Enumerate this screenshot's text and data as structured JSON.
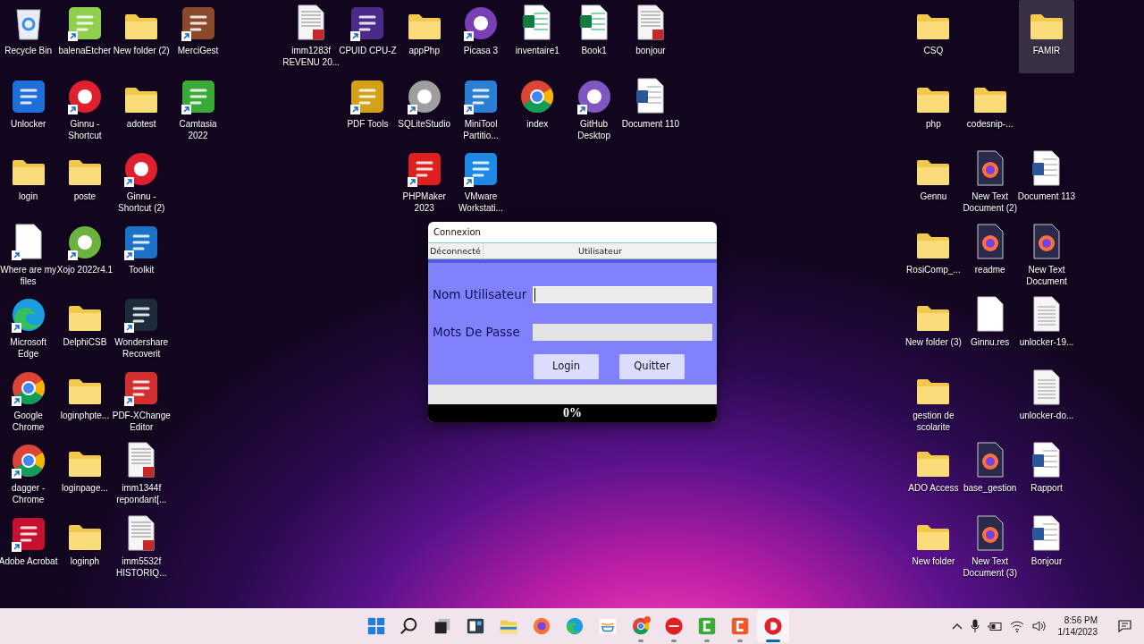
{
  "desktop": {
    "groups": [
      {
        "columns": [
          {
            "icons": [
              {
                "label": "Recycle Bin",
                "kind": "recycle-bin",
                "shortcut": false,
                "selected": false
              },
              {
                "label": "Unlocker",
                "kind": "app-tile",
                "color": "#1e6fd9",
                "shortcut": false,
                "selected": false
              },
              {
                "label": "login",
                "kind": "folder",
                "shortcut": false,
                "selected": false
              },
              {
                "label": "Where are my files",
                "kind": "blank-file",
                "shortcut": true,
                "selected": false
              },
              {
                "label": "Microsoft Edge",
                "kind": "edge",
                "shortcut": true,
                "selected": false
              },
              {
                "label": "Google Chrome",
                "kind": "chrome",
                "shortcut": true,
                "selected": false
              },
              {
                "label": "dagger - Chrome",
                "kind": "chrome",
                "shortcut": true,
                "selected": false
              },
              {
                "label": "Adobe Acrobat",
                "kind": "app-tile",
                "color": "#c8102e",
                "shortcut": true,
                "selected": false
              }
            ]
          },
          {
            "icons": [
              {
                "label": "balenaEtcher",
                "kind": "app-tile",
                "color": "#8fd14f",
                "shortcut": true,
                "selected": false
              },
              {
                "label": "Ginnu - Shortcut",
                "kind": "app-round",
                "color": "#e0202e",
                "shortcut": true,
                "selected": false
              },
              {
                "label": "poste",
                "kind": "folder",
                "shortcut": false,
                "selected": false
              },
              {
                "label": "Xojo 2022r4.1",
                "kind": "app-round",
                "color": "#6ab33e",
                "shortcut": true,
                "selected": false
              },
              {
                "label": "DelphiCSB",
                "kind": "folder",
                "shortcut": false,
                "selected": false
              },
              {
                "label": "loginphpte...",
                "kind": "folder",
                "shortcut": false,
                "selected": false
              },
              {
                "label": "loginpage...",
                "kind": "folder",
                "shortcut": false,
                "selected": false
              },
              {
                "label": "loginph",
                "kind": "folder",
                "shortcut": false,
                "selected": false
              }
            ]
          },
          {
            "icons": [
              {
                "label": "New folder (2)",
                "kind": "folder",
                "shortcut": false,
                "selected": false
              },
              {
                "label": "adotest",
                "kind": "folder",
                "shortcut": false,
                "selected": false
              },
              {
                "label": "Ginnu - Shortcut (2)",
                "kind": "app-round",
                "color": "#e0202e",
                "shortcut": true,
                "selected": false
              },
              {
                "label": "Toolkit",
                "kind": "app-tile",
                "color": "#1a73c8",
                "shortcut": true,
                "selected": false
              },
              {
                "label": "Wondershare Recoverit",
                "kind": "app-tile",
                "color": "#1c2b3a",
                "shortcut": true,
                "selected": false
              },
              {
                "label": "PDF-XChange Editor",
                "kind": "app-tile",
                "color": "#d32f2f",
                "shortcut": true,
                "selected": false
              },
              {
                "label": "imm1344f repondant[...",
                "kind": "pdf-file",
                "shortcut": false,
                "selected": false
              },
              {
                "label": "imm5532f HISTORIQ...",
                "kind": "pdf-file",
                "shortcut": false,
                "selected": false
              }
            ]
          },
          {
            "icons": [
              {
                "label": "MerciGest",
                "kind": "app-tile",
                "color": "#8b4a2b",
                "shortcut": true,
                "selected": false
              },
              {
                "label": "Camtasia 2022",
                "kind": "app-tile",
                "color": "#3aa935",
                "shortcut": true,
                "selected": false
              }
            ]
          }
        ]
      },
      {
        "columns": [
          {
            "icons": [
              {
                "label": "imm1283f REVENU 20...",
                "kind": "pdf-file",
                "shortcut": false,
                "selected": false
              }
            ]
          },
          {
            "icons": [
              {
                "label": "CPUID CPU-Z",
                "kind": "app-tile",
                "color": "#4b2a8a",
                "shortcut": true,
                "selected": false
              },
              {
                "label": "PDF Tools",
                "kind": "app-tile",
                "color": "#d4a017",
                "shortcut": true,
                "selected": false
              }
            ]
          },
          {
            "icons": [
              {
                "label": "appPhp",
                "kind": "folder",
                "shortcut": false,
                "selected": false
              },
              {
                "label": "SQLiteStudio",
                "kind": "app-round",
                "color": "#9e9e9e",
                "shortcut": true,
                "selected": false
              },
              {
                "label": "PHPMaker 2023",
                "kind": "app-tile",
                "color": "#e02020",
                "shortcut": true,
                "selected": false
              }
            ]
          },
          {
            "icons": [
              {
                "label": "Picasa 3",
                "kind": "app-round",
                "color": "#7b3fb5",
                "shortcut": true,
                "selected": false
              },
              {
                "label": "MiniTool Partitio...",
                "kind": "app-tile",
                "color": "#2a7fd4",
                "shortcut": true,
                "selected": false
              },
              {
                "label": "VMware Workstati...",
                "kind": "app-tile",
                "color": "#1e88e5",
                "shortcut": true,
                "selected": false
              }
            ]
          },
          {
            "icons": [
              {
                "label": "inventaire1",
                "kind": "excel-file",
                "shortcut": false,
                "selected": false
              },
              {
                "label": "index",
                "kind": "chrome",
                "shortcut": false,
                "selected": false
              }
            ]
          },
          {
            "icons": [
              {
                "label": "Book1",
                "kind": "excel-file",
                "shortcut": false,
                "selected": false
              },
              {
                "label": "GitHub Desktop",
                "kind": "app-round",
                "color": "#7e57c2",
                "shortcut": true,
                "selected": false
              }
            ]
          },
          {
            "icons": [
              {
                "label": "bonjour",
                "kind": "pdf-file",
                "shortcut": false,
                "selected": false
              },
              {
                "label": "Document 110",
                "kind": "word-file",
                "shortcut": false,
                "selected": false
              }
            ]
          }
        ]
      },
      {
        "columns": [
          {
            "icons": [
              {
                "label": "CSQ",
                "kind": "folder",
                "shortcut": false,
                "selected": false
              },
              {
                "label": "php",
                "kind": "folder",
                "shortcut": false,
                "selected": false
              },
              {
                "label": "Gennu",
                "kind": "folder",
                "shortcut": false,
                "selected": false
              },
              {
                "label": "RosiComp_...",
                "kind": "folder",
                "shortcut": false,
                "selected": false
              },
              {
                "label": "New folder (3)",
                "kind": "folder",
                "shortcut": false,
                "selected": false
              },
              {
                "label": "gestion de scolarite",
                "kind": "folder",
                "shortcut": false,
                "selected": false
              },
              {
                "label": "ADO Access",
                "kind": "folder",
                "shortcut": false,
                "selected": false
              },
              {
                "label": "New folder",
                "kind": "folder",
                "shortcut": false,
                "selected": false
              }
            ]
          },
          {
            "icons": [
              {
                "kind": "gap"
              },
              {
                "label": "codesnip-...",
                "kind": "folder",
                "shortcut": false,
                "selected": false
              },
              {
                "label": "New Text Document (2)",
                "kind": "firefox-file",
                "shortcut": false,
                "selected": false
              },
              {
                "label": "readme",
                "kind": "firefox-file",
                "shortcut": false,
                "selected": false
              },
              {
                "label": "Ginnu.res",
                "kind": "blank-file",
                "shortcut": false,
                "selected": false
              },
              {
                "kind": "gap"
              },
              {
                "label": "base_gestion",
                "kind": "firefox-file",
                "shortcut": false,
                "selected": false
              },
              {
                "label": "New Text Document (3)",
                "kind": "firefox-file",
                "shortcut": false,
                "selected": false
              }
            ]
          },
          {
            "icons": [
              {
                "label": "FAMIR",
                "kind": "folder",
                "shortcut": false,
                "selected": true
              },
              {
                "kind": "gap"
              },
              {
                "label": "Document 113",
                "kind": "word-file",
                "shortcut": false,
                "selected": false
              },
              {
                "label": "New Text Document",
                "kind": "firefox-file",
                "shortcut": false,
                "selected": false
              },
              {
                "label": "unlocker-19...",
                "kind": "text-file",
                "shortcut": false,
                "selected": false
              },
              {
                "label": "unlocker-do...",
                "kind": "text-file",
                "shortcut": false,
                "selected": false
              },
              {
                "label": "Rapport",
                "kind": "word-file",
                "shortcut": false,
                "selected": false
              },
              {
                "label": "Bonjour",
                "kind": "word-file",
                "shortcut": false,
                "selected": false
              }
            ]
          }
        ]
      }
    ]
  },
  "window": {
    "title": "Connexion",
    "status_left": "Déconnecté",
    "status_right": "Utilisateur",
    "fields": [
      {
        "label": "Nom Utilisateur",
        "focused": true
      },
      {
        "label": "Mots De Passe",
        "focused": false
      }
    ],
    "buttons": [
      "Login",
      "Quitter"
    ],
    "progress": {
      "level": 0,
      "reading": "0%"
    }
  },
  "taskbar": {
    "items": [
      {
        "kind": "start",
        "running": false,
        "active": false
      },
      {
        "kind": "search",
        "running": false,
        "active": false
      },
      {
        "kind": "task-view",
        "running": false,
        "active": false
      },
      {
        "kind": "widgets",
        "running": false,
        "active": false
      },
      {
        "kind": "explorer",
        "running": false,
        "active": false
      },
      {
        "kind": "firefox",
        "running": false,
        "active": false
      },
      {
        "kind": "edge",
        "running": false,
        "active": false
      },
      {
        "kind": "amazon",
        "running": false,
        "active": false
      },
      {
        "kind": "chrome",
        "running": true,
        "active": false
      },
      {
        "kind": "rad",
        "running": true,
        "active": false
      },
      {
        "kind": "camtasia",
        "running": true,
        "active": false
      },
      {
        "kind": "orange-app",
        "running": true,
        "active": false
      },
      {
        "kind": "ginnu",
        "running": true,
        "active": true
      }
    ],
    "time": "8:56 PM",
    "date": "1/14/2023"
  }
}
